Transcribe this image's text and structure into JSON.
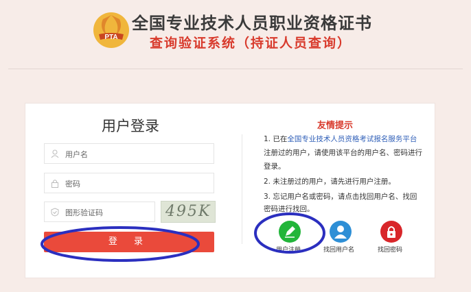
{
  "header": {
    "logo_text": "PTA",
    "title": "全国专业技术人员职业资格证书",
    "subtitle": "查询验证系统（持证人员查询）"
  },
  "login": {
    "title": "用户登录",
    "username_placeholder": "用户名",
    "password_placeholder": "密码",
    "captcha_placeholder": "图形验证码",
    "captcha_text": "495K",
    "submit_label": "登 录"
  },
  "tips": {
    "title": "友情提示",
    "line1_prefix": "1. 已在",
    "line1_link": "全国专业技术人员资格考试报名服务平台",
    "line1_cont": "注册过的用户，请使用该平台的用户名、密码进行",
    "line1_end": "登录。",
    "line2": "2. 未注册过的用户，请先进行用户注册。",
    "line3": "3. 忘记用户名或密码，请点击找回用户名、找回",
    "line3_end": "密码进行找回。"
  },
  "actions": [
    {
      "label": "用户注册",
      "color": "#22b53a",
      "icon": "pencil-icon"
    },
    {
      "label": "找回用户名",
      "color": "#2e8fd6",
      "icon": "user-icon"
    },
    {
      "label": "找回密码",
      "color": "#d8262a",
      "icon": "lock-icon"
    }
  ],
  "colors": {
    "accent_red": "#d83a2c",
    "button_red": "#ea4a3b",
    "annotation_blue": "#2b2fbf"
  }
}
